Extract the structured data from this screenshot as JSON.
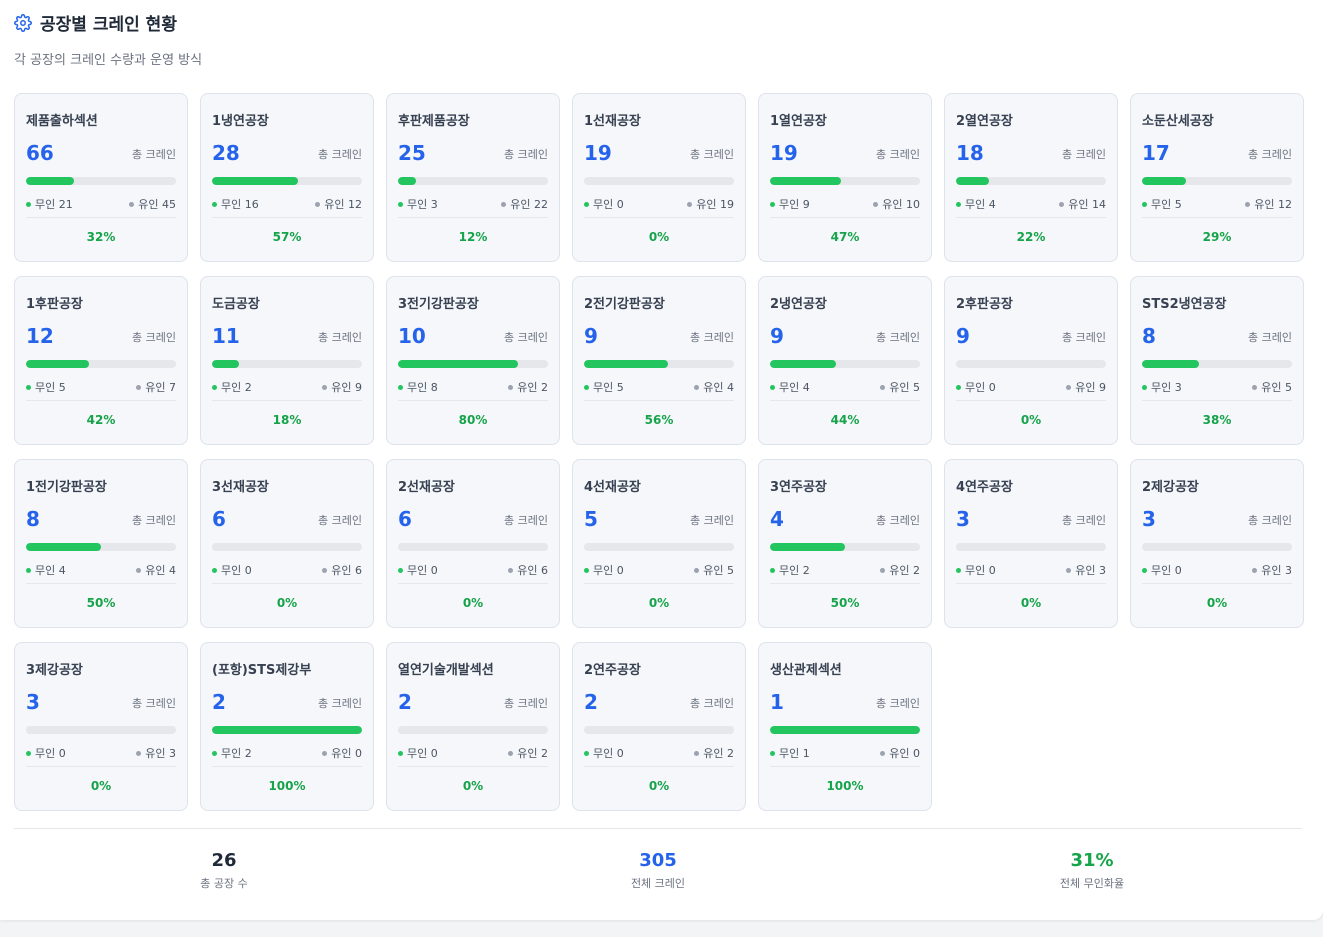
{
  "header": {
    "title": "공장별 크레인 현황",
    "subtitle": "각 공장의 크레인 수량과 운영 방식",
    "icon": "gear-icon"
  },
  "total_label": "총 크레인",
  "unmanned_prefix": "무인",
  "manned_prefix": "유인",
  "colors": {
    "accent": "#2563eb",
    "bar": "#22c55e",
    "pct": "#16a34a"
  },
  "factories": [
    {
      "name": "제품출하섹션",
      "total": "66",
      "unmanned": "무인 21",
      "manned": "유인 45",
      "pct": "32%",
      "ratio": 0.32
    },
    {
      "name": "1냉연공장",
      "total": "28",
      "unmanned": "무인 16",
      "manned": "유인 12",
      "pct": "57%",
      "ratio": 0.57
    },
    {
      "name": "후판제품공장",
      "total": "25",
      "unmanned": "무인 3",
      "manned": "유인 22",
      "pct": "12%",
      "ratio": 0.12
    },
    {
      "name": "1선재공장",
      "total": "19",
      "unmanned": "무인 0",
      "manned": "유인 19",
      "pct": "0%",
      "ratio": 0
    },
    {
      "name": "1열연공장",
      "total": "19",
      "unmanned": "무인 9",
      "manned": "유인 10",
      "pct": "47%",
      "ratio": 0.47
    },
    {
      "name": "2열연공장",
      "total": "18",
      "unmanned": "무인 4",
      "manned": "유인 14",
      "pct": "22%",
      "ratio": 0.22
    },
    {
      "name": "소둔산세공장",
      "total": "17",
      "unmanned": "무인 5",
      "manned": "유인 12",
      "pct": "29%",
      "ratio": 0.29
    },
    {
      "name": "1후판공장",
      "total": "12",
      "unmanned": "무인 5",
      "manned": "유인 7",
      "pct": "42%",
      "ratio": 0.42
    },
    {
      "name": "도금공장",
      "total": "11",
      "unmanned": "무인 2",
      "manned": "유인 9",
      "pct": "18%",
      "ratio": 0.18
    },
    {
      "name": "3전기강판공장",
      "total": "10",
      "unmanned": "무인 8",
      "manned": "유인 2",
      "pct": "80%",
      "ratio": 0.8
    },
    {
      "name": "2전기강판공장",
      "total": "9",
      "unmanned": "무인 5",
      "manned": "유인 4",
      "pct": "56%",
      "ratio": 0.56
    },
    {
      "name": "2냉연공장",
      "total": "9",
      "unmanned": "무인 4",
      "manned": "유인 5",
      "pct": "44%",
      "ratio": 0.44
    },
    {
      "name": "2후판공장",
      "total": "9",
      "unmanned": "무인 0",
      "manned": "유인 9",
      "pct": "0%",
      "ratio": 0
    },
    {
      "name": "STS2냉연공장",
      "total": "8",
      "unmanned": "무인 3",
      "manned": "유인 5",
      "pct": "38%",
      "ratio": 0.38
    },
    {
      "name": "1전기강판공장",
      "total": "8",
      "unmanned": "무인 4",
      "manned": "유인 4",
      "pct": "50%",
      "ratio": 0.5
    },
    {
      "name": "3선재공장",
      "total": "6",
      "unmanned": "무인 0",
      "manned": "유인 6",
      "pct": "0%",
      "ratio": 0
    },
    {
      "name": "2선재공장",
      "total": "6",
      "unmanned": "무인 0",
      "manned": "유인 6",
      "pct": "0%",
      "ratio": 0
    },
    {
      "name": "4선재공장",
      "total": "5",
      "unmanned": "무인 0",
      "manned": "유인 5",
      "pct": "0%",
      "ratio": 0
    },
    {
      "name": "3연주공장",
      "total": "4",
      "unmanned": "무인 2",
      "manned": "유인 2",
      "pct": "50%",
      "ratio": 0.5
    },
    {
      "name": "4연주공장",
      "total": "3",
      "unmanned": "무인 0",
      "manned": "유인 3",
      "pct": "0%",
      "ratio": 0
    },
    {
      "name": "2제강공장",
      "total": "3",
      "unmanned": "무인 0",
      "manned": "유인 3",
      "pct": "0%",
      "ratio": 0
    },
    {
      "name": "3제강공장",
      "total": "3",
      "unmanned": "무인 0",
      "manned": "유인 3",
      "pct": "0%",
      "ratio": 0
    },
    {
      "name": "(포항)STS제강부",
      "total": "2",
      "unmanned": "무인 2",
      "manned": "유인 0",
      "pct": "100%",
      "ratio": 1
    },
    {
      "name": "열연기술개발섹션",
      "total": "2",
      "unmanned": "무인 0",
      "manned": "유인 2",
      "pct": "0%",
      "ratio": 0
    },
    {
      "name": "2연주공장",
      "total": "2",
      "unmanned": "무인 0",
      "manned": "유인 2",
      "pct": "0%",
      "ratio": 0
    },
    {
      "name": "생산관제섹션",
      "total": "1",
      "unmanned": "무인 1",
      "manned": "유인 0",
      "pct": "100%",
      "ratio": 1
    }
  ],
  "summary": {
    "factories": {
      "value": "26",
      "label": "총 공장 수",
      "color": "#1f2937"
    },
    "cranes": {
      "value": "305",
      "label": "전체 크레인",
      "color": "#2563eb"
    },
    "rate": {
      "value": "31%",
      "label": "전체 무인화율",
      "color": "#16a34a"
    }
  }
}
